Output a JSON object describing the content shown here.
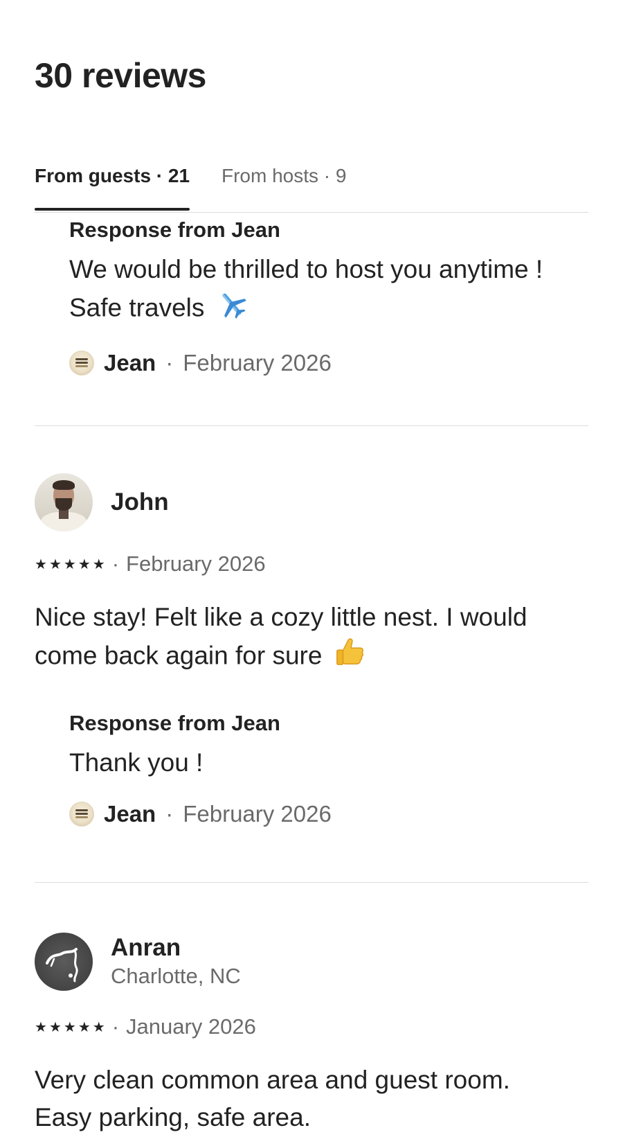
{
  "header": {
    "title": "30 reviews"
  },
  "tabs": [
    {
      "label": "From guests · 21",
      "active": true
    },
    {
      "label": "From hosts · 9",
      "active": false
    }
  ],
  "reviews": [
    {
      "response": {
        "heading": "Response from Jean",
        "text": "We would be thrilled to host you anytime ! Safe travels",
        "emoji": "airplane",
        "responder_name": "Jean",
        "separator": "·",
        "date": "February 2026"
      }
    },
    {
      "reviewer_name": "John",
      "rating": 5,
      "separator": "·",
      "date": "February 2026",
      "text": "Nice stay! Felt like a cozy little nest. I would come back again for sure",
      "emoji": "thumbs-up",
      "response": {
        "heading": "Response from Jean",
        "text": "Thank you !",
        "responder_name": "Jean",
        "separator": "·",
        "date": "February 2026"
      }
    },
    {
      "reviewer_name": "Anran",
      "location": "Charlotte, NC",
      "rating": 5,
      "separator": "·",
      "date": "January 2026",
      "text": "Very clean common area and guest room. Easy parking, safe area."
    }
  ],
  "colors": {
    "text_primary": "#222222",
    "text_secondary": "#6a6a6a",
    "divider": "#dddddd"
  }
}
